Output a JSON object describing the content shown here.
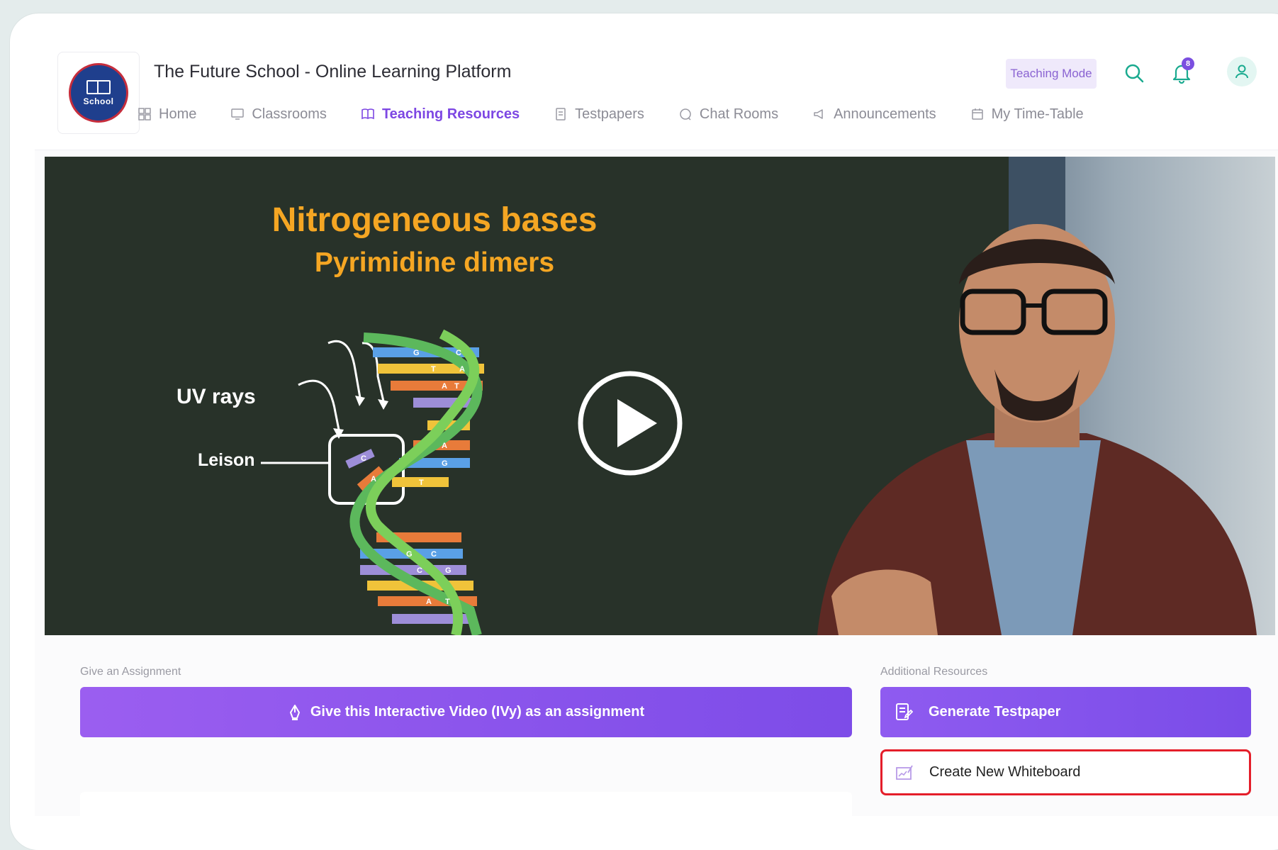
{
  "header": {
    "logo_text": "School",
    "title": "The Future School - Online Learning Platform",
    "mode_badge": "Teaching Mode",
    "notification_count": "8"
  },
  "nav": {
    "items": [
      {
        "label": "Home",
        "icon": "grid-icon"
      },
      {
        "label": "Classrooms",
        "icon": "monitor-icon"
      },
      {
        "label": "Teaching Resources",
        "icon": "book-icon",
        "active": true
      },
      {
        "label": "Testpapers",
        "icon": "document-icon"
      },
      {
        "label": "Chat Rooms",
        "icon": "chat-icon"
      },
      {
        "label": "Announcements",
        "icon": "megaphone-icon"
      },
      {
        "label": "My Time-Table",
        "icon": "calendar-icon"
      }
    ]
  },
  "video": {
    "title": "Nitrogeneous bases",
    "subtitle": "Pyrimidine dimers",
    "label_uv": "UV rays",
    "label_leison": "Leison",
    "base_letters": [
      "G",
      "C",
      "T",
      "A",
      "A",
      "T",
      "A",
      "G",
      "C",
      "A",
      "T",
      "G",
      "C",
      "C",
      "G",
      "A",
      "T"
    ]
  },
  "assignment": {
    "section_label": "Give an Assignment",
    "button_label": "Give this Interactive Video (IVy) as an assignment"
  },
  "resources": {
    "section_label": "Additional Resources",
    "generate_label": "Generate Testpaper",
    "whiteboard_label": "Create New Whiteboard"
  },
  "colors": {
    "accent": "#7d47e3",
    "highlight_border": "#e41e2a",
    "title_orange": "#f5a623"
  }
}
